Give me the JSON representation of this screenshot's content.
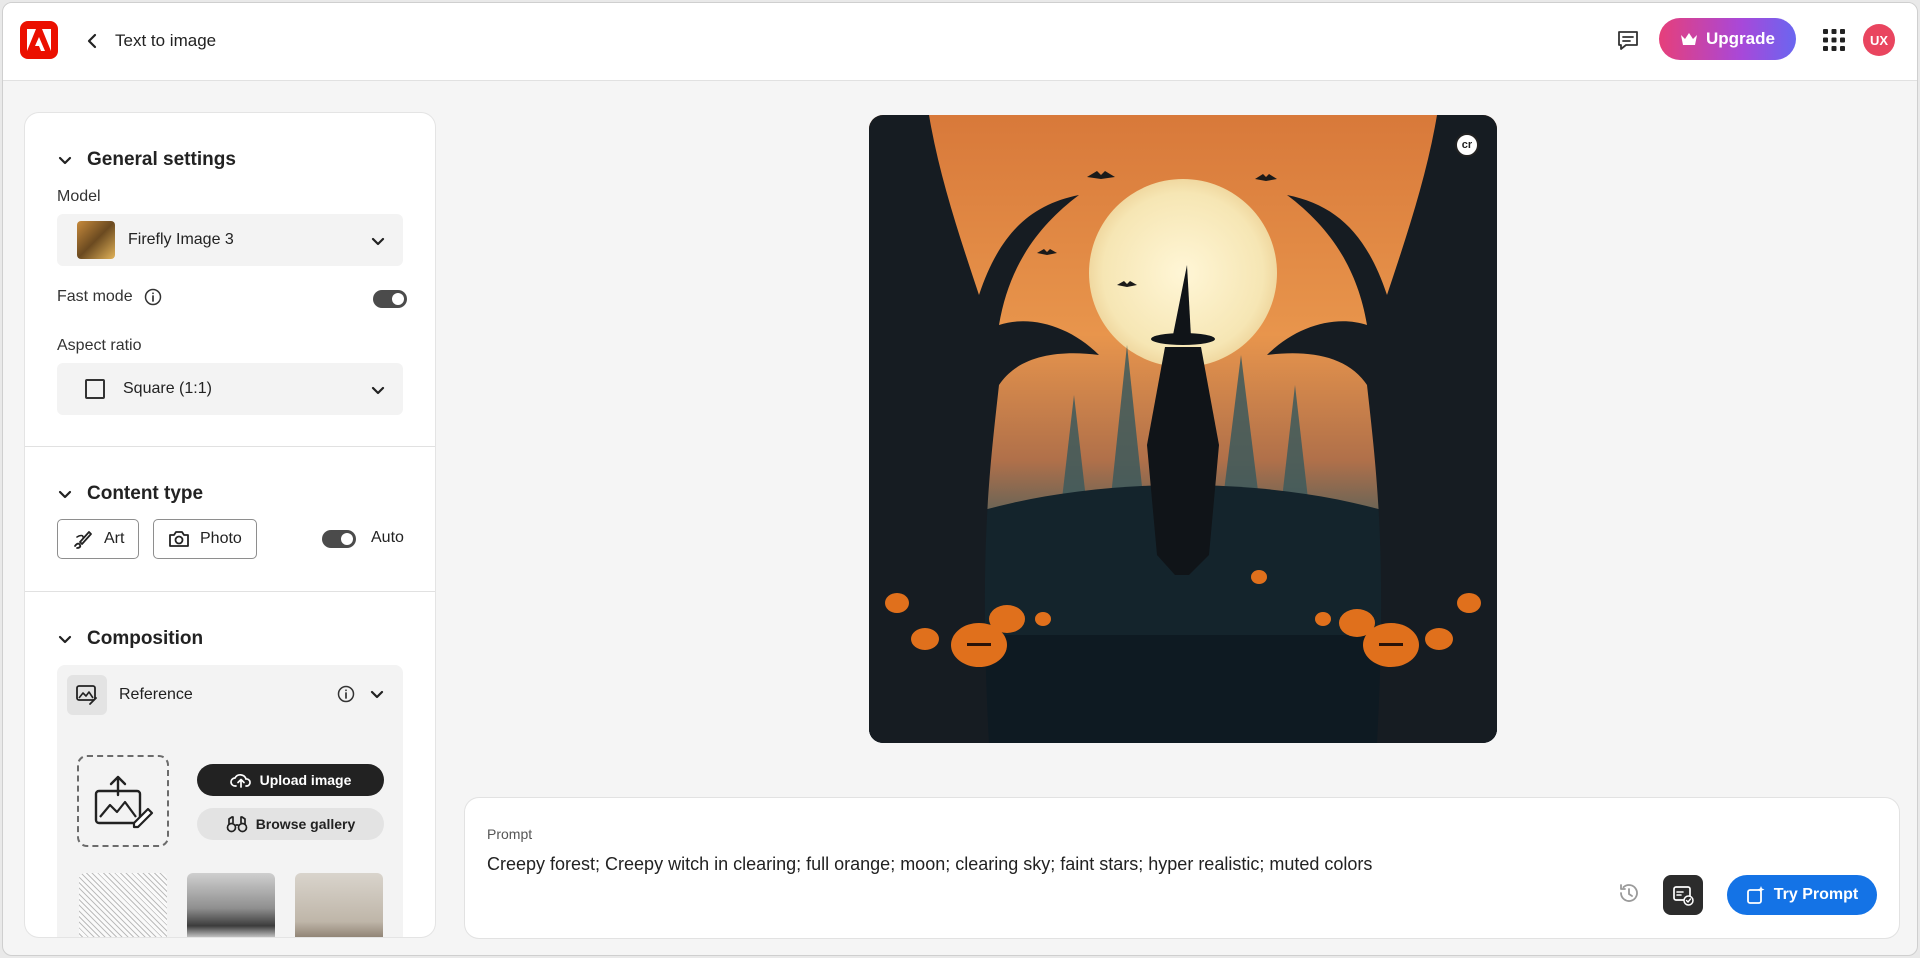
{
  "header": {
    "back_label": "Text to image",
    "upgrade_label": "Upgrade",
    "avatar_initials": "UX",
    "brand_color": "#eb1000"
  },
  "sidebar": {
    "general": {
      "title": "General settings",
      "model_label": "Model",
      "model_value": "Firefly Image 3",
      "fast_mode_label": "Fast mode",
      "fast_mode_on": true,
      "aspect_label": "Aspect ratio",
      "aspect_value": "Square (1:1)"
    },
    "content_type": {
      "title": "Content type",
      "art_label": "Art",
      "photo_label": "Photo",
      "auto_label": "Auto",
      "auto_on": true
    },
    "composition": {
      "title": "Composition",
      "reference_label": "Reference",
      "upload_label": "Upload image",
      "browse_label": "Browse gallery"
    }
  },
  "main": {
    "image_badge": "cr"
  },
  "prompt": {
    "label": "Prompt",
    "text": "Creepy forest; Creepy witch in clearing; full orange; moon; clearing sky; faint stars; hyper realistic; muted colors",
    "try_label": "Try Prompt",
    "accent_color": "#1473e6"
  }
}
